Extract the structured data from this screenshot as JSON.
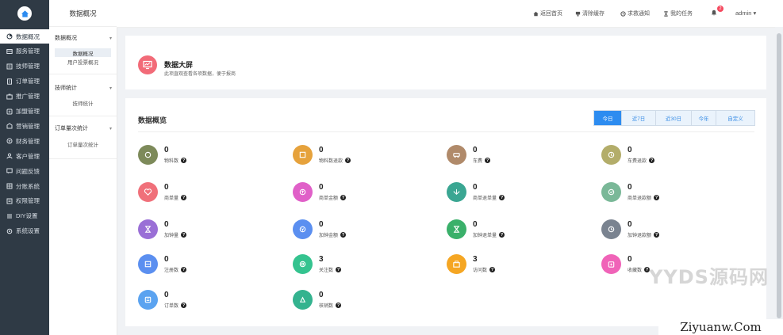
{
  "sidebar": {
    "items": [
      {
        "label": "数据概况",
        "icon": "dashboard-icon",
        "active": true
      },
      {
        "label": "服务管理",
        "icon": "service-icon",
        "active": false
      },
      {
        "label": "技师管理",
        "icon": "technician-icon",
        "active": false
      },
      {
        "label": "订单管理",
        "icon": "order-icon",
        "active": false
      },
      {
        "label": "推广管理",
        "icon": "promotion-icon",
        "active": false
      },
      {
        "label": "加盟管理",
        "icon": "franchise-icon",
        "active": false
      },
      {
        "label": "营销管理",
        "icon": "marketing-icon",
        "active": false
      },
      {
        "label": "财务管理",
        "icon": "finance-icon",
        "active": false
      },
      {
        "label": "客户管理",
        "icon": "customer-icon",
        "active": false
      },
      {
        "label": "问题反馈",
        "icon": "feedback-icon",
        "active": false
      },
      {
        "label": "分账系统",
        "icon": "split-icon",
        "active": false
      },
      {
        "label": "权限管理",
        "icon": "permission-icon",
        "active": false
      },
      {
        "label": "DIY设置",
        "icon": "diy-icon",
        "active": false
      },
      {
        "label": "系统设置",
        "icon": "settings-icon",
        "active": false
      }
    ]
  },
  "subnav": {
    "title": "数据概况",
    "groups": [
      {
        "label": "数据概况",
        "items": [
          "数据概况",
          "用户投票概况"
        ]
      },
      {
        "label": "技师统计",
        "items": [
          "技师统计"
        ]
      },
      {
        "label": "订单量次统计",
        "items": [
          "订单量次统计"
        ]
      }
    ]
  },
  "topbar": {
    "links": [
      {
        "label": "返回首页",
        "icon": "home-icon"
      },
      {
        "label": "清除缓存",
        "icon": "clear-cache-icon"
      },
      {
        "label": "求救通知",
        "icon": "alert-icon"
      },
      {
        "label": "我的任务",
        "icon": "task-icon"
      }
    ],
    "badge": "2",
    "user": "admin ▾"
  },
  "big_screen": {
    "title": "数据大屏",
    "subtitle": "此项直观查看各项数据，便于报商"
  },
  "overview": {
    "title": "数据概览",
    "tabs": [
      {
        "label": "今日",
        "active": true
      },
      {
        "label": "近7日",
        "active": false
      },
      {
        "label": "近30日",
        "active": false
      },
      {
        "label": "今年",
        "active": false
      },
      {
        "label": "自定义",
        "active": false
      }
    ],
    "stats": [
      {
        "value": "0",
        "label": "物料数",
        "color": "#7d8a5a",
        "icon": "coin-icon"
      },
      {
        "value": "0",
        "label": "物料数退款",
        "color": "#e6a23c",
        "icon": "refund-icon"
      },
      {
        "value": "0",
        "label": "车费",
        "color": "#b08a6a",
        "icon": "car-icon"
      },
      {
        "value": "0",
        "label": "车费退款",
        "color": "#b3ad6a",
        "icon": "car-refund-icon"
      },
      {
        "value": "0",
        "label": "商单量",
        "color": "#f0707a",
        "icon": "heart-icon"
      },
      {
        "value": "0",
        "label": "商单金额",
        "color": "#e060c8",
        "icon": "money-icon"
      },
      {
        "value": "0",
        "label": "商单退单量",
        "color": "#3aa692",
        "icon": "return-icon"
      },
      {
        "value": "0",
        "label": "商单退款额",
        "color": "#7ab898",
        "icon": "refund-amount-icon"
      },
      {
        "value": "0",
        "label": "加钟量",
        "color": "#9a6fd6",
        "icon": "hourglass-icon"
      },
      {
        "value": "0",
        "label": "加钟金额",
        "color": "#5b8ff0",
        "icon": "amount-icon"
      },
      {
        "value": "0",
        "label": "加钟退单量",
        "color": "#3ab06a",
        "icon": "hourglass-return-icon"
      },
      {
        "value": "0",
        "label": "加钟退款额",
        "color": "#7a8390",
        "icon": "refund-clock-icon"
      },
      {
        "value": "0",
        "label": "注册数",
        "color": "#5b8ff0",
        "icon": "register-icon"
      },
      {
        "value": "3",
        "label": "关注数",
        "color": "#34c38f",
        "icon": "follow-icon"
      },
      {
        "value": "3",
        "label": "访问数",
        "color": "#f5a623",
        "icon": "visit-icon"
      },
      {
        "value": "0",
        "label": "收藏数",
        "color": "#f063b8",
        "icon": "favorite-icon"
      },
      {
        "value": "0",
        "label": "订单数",
        "color": "#5ba3f0",
        "icon": "order-count-icon"
      },
      {
        "value": "0",
        "label": "核销数",
        "color": "#34b38f",
        "icon": "verify-icon"
      }
    ]
  },
  "watermarks": {
    "top": "YYDS源码网",
    "bottom": "Ziyuanw.Com"
  }
}
